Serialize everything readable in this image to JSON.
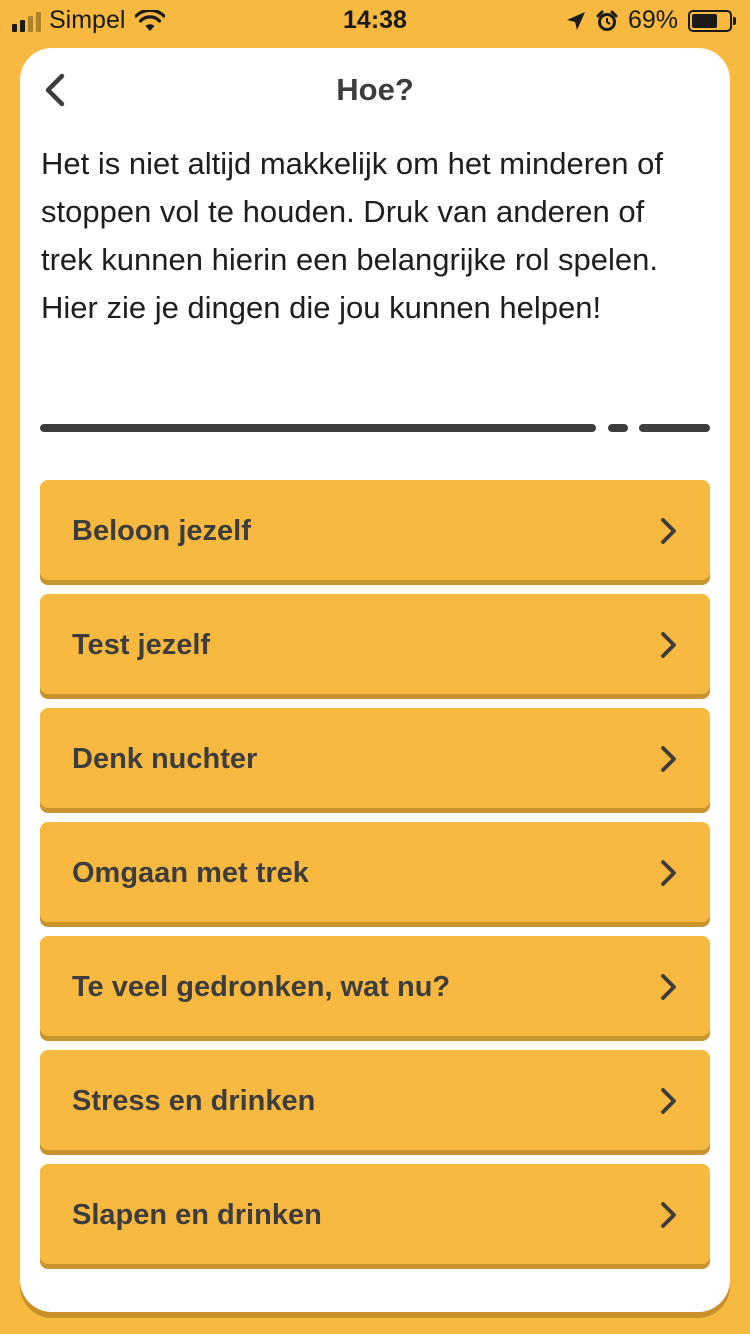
{
  "status_bar": {
    "carrier": "Simpel",
    "time": "14:38",
    "battery_percent": "69%",
    "battery_level": 0.69
  },
  "header": {
    "title": "Hoe?"
  },
  "intro_text": "Het is niet altijd makkelijk om het minderen of stoppen vol te houden. Druk van anderen of trek kunnen hierin een belangrijke rol spelen. Hier zie je dingen die jou kunnen helpen!",
  "menu": {
    "items": [
      {
        "label": "Beloon jezelf"
      },
      {
        "label": "Test jezelf"
      },
      {
        "label": "Denk nuchter"
      },
      {
        "label": "Omgaan met trek"
      },
      {
        "label": "Te veel gedronken, wat nu?"
      },
      {
        "label": "Stress en drinken"
      },
      {
        "label": "Slapen en drinken"
      }
    ]
  },
  "colors": {
    "background": "#f8b940",
    "card": "#ffffff",
    "text": "#3d3d3d"
  }
}
